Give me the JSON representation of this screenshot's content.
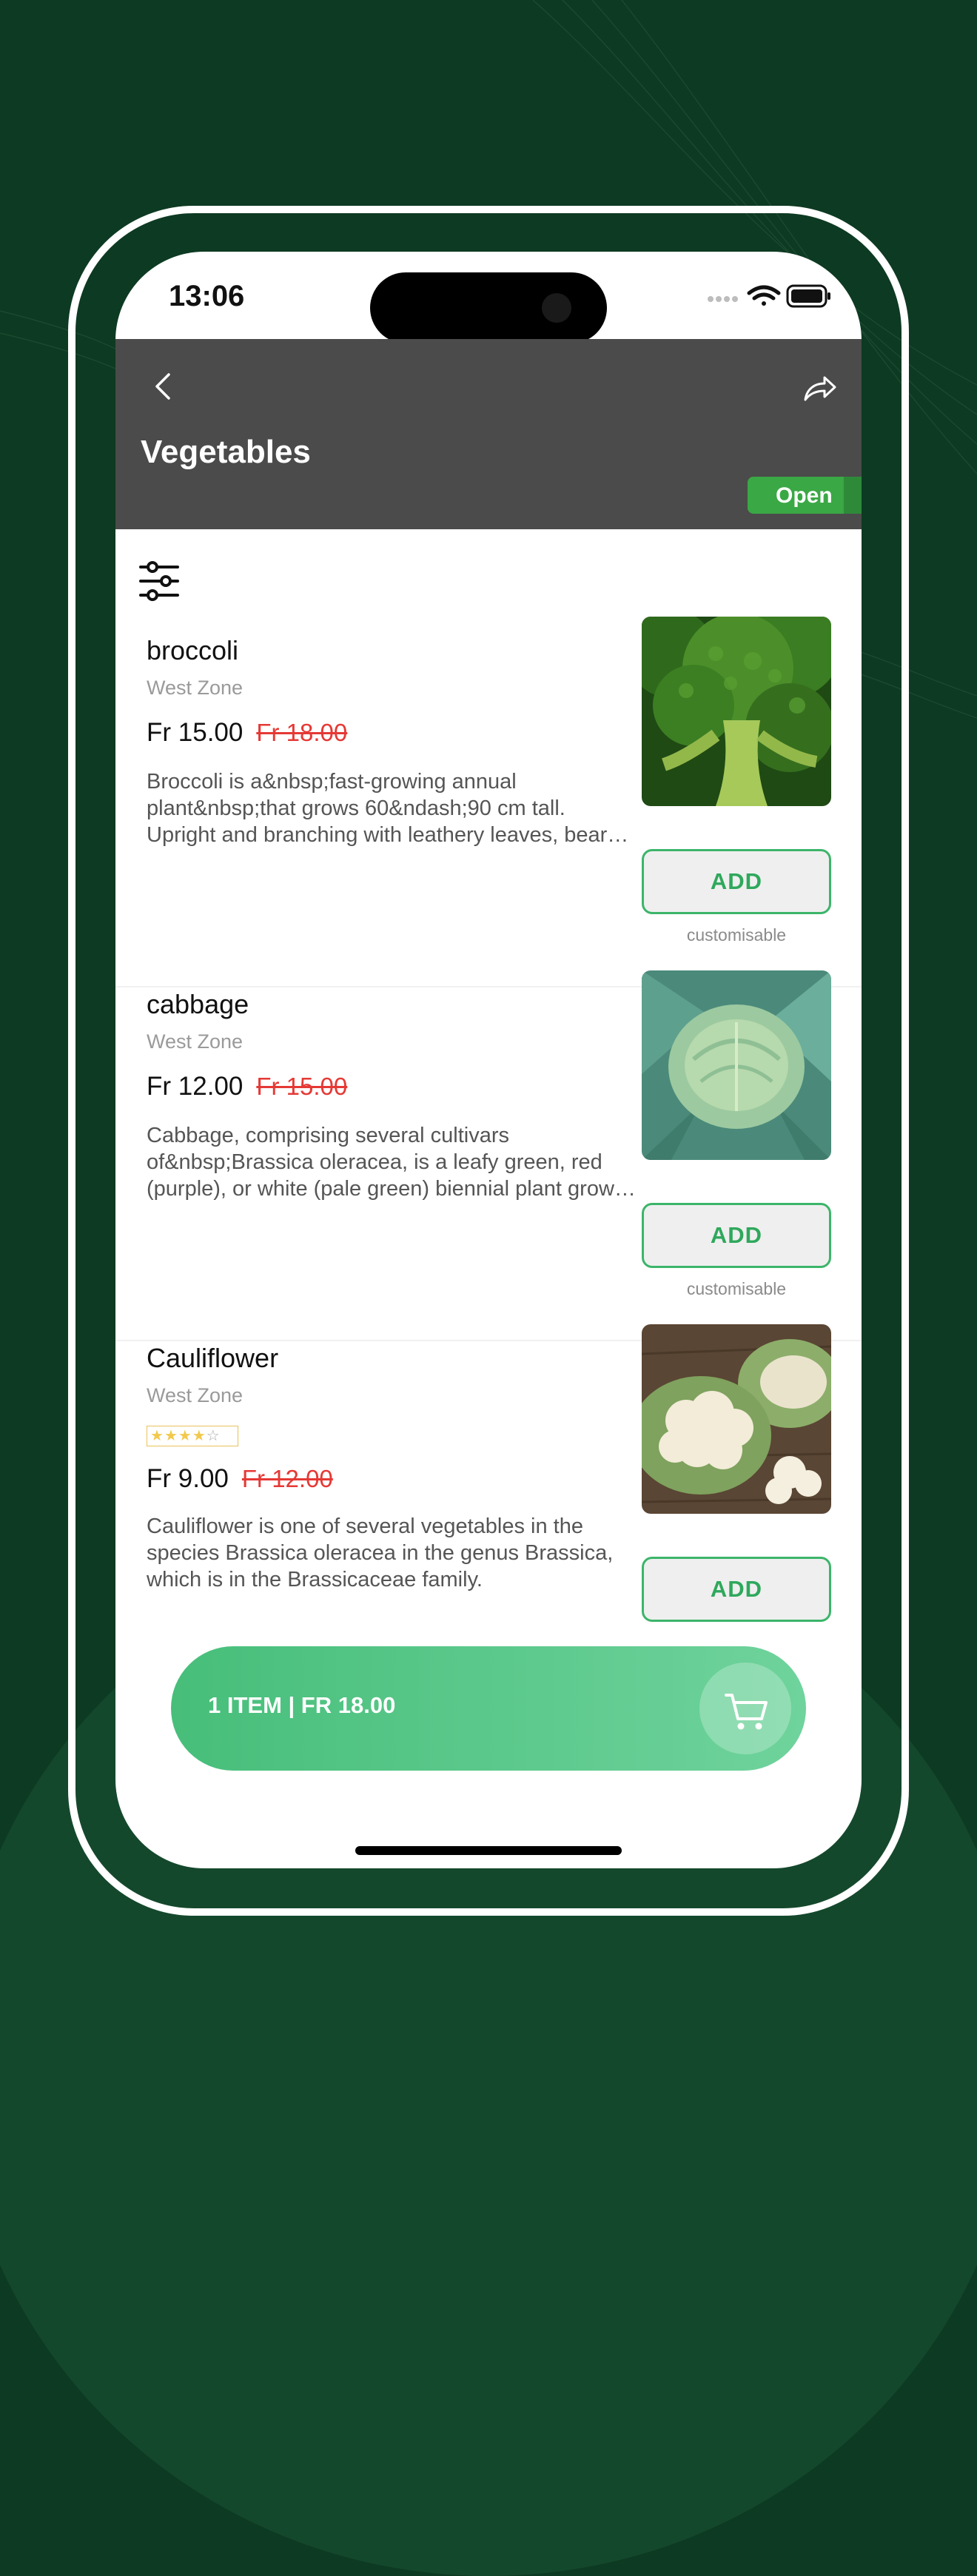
{
  "status_bar": {
    "time": "13:06"
  },
  "header": {
    "title": "Vegetables",
    "badge": "Open"
  },
  "products": [
    {
      "name": "broccoli",
      "zone": "West Zone",
      "price": "Fr 15.00",
      "old_price": "Fr 18.00",
      "description": "Broccoli is a&nbsp;fast-growing annual plant&nbsp;that grows 60&ndash;90 cm tall. Upright and branching with leathery leaves, bears dense green clusters of flower buds",
      "add_label": "ADD",
      "customisable": "customisable",
      "image": "broccoli-photo"
    },
    {
      "name": "cabbage",
      "zone": "West Zone",
      "price": "Fr 12.00",
      "old_price": "Fr 15.00",
      "description": "Cabbage, comprising several cultivars of&nbsp;Brassica oleracea, is a leafy green, red (purple), or white (pale green) biennial plant grown as an annual vegetable crop",
      "add_label": "ADD",
      "customisable": "customisable",
      "image": "cabbage-photo"
    },
    {
      "name": "Cauliflower",
      "zone": "West Zone",
      "rating": 4,
      "price": "Fr 9.00",
      "old_price": "Fr 12.00",
      "description": "Cauliflower is one of several vegetables in the species Brassica oleracea in the genus Brassica, which is in the Brassicaceae family.",
      "add_label": "ADD",
      "image": "cauliflower-photo"
    }
  ],
  "cart": {
    "summary": "1 ITEM | FR 18.00",
    "icon": "cart-icon"
  },
  "colors": {
    "accent": "#3cb56a",
    "header_bg": "#4b4b4b",
    "badge": "#3aa845",
    "strike": "#e53935",
    "background": "#0d3a22"
  }
}
